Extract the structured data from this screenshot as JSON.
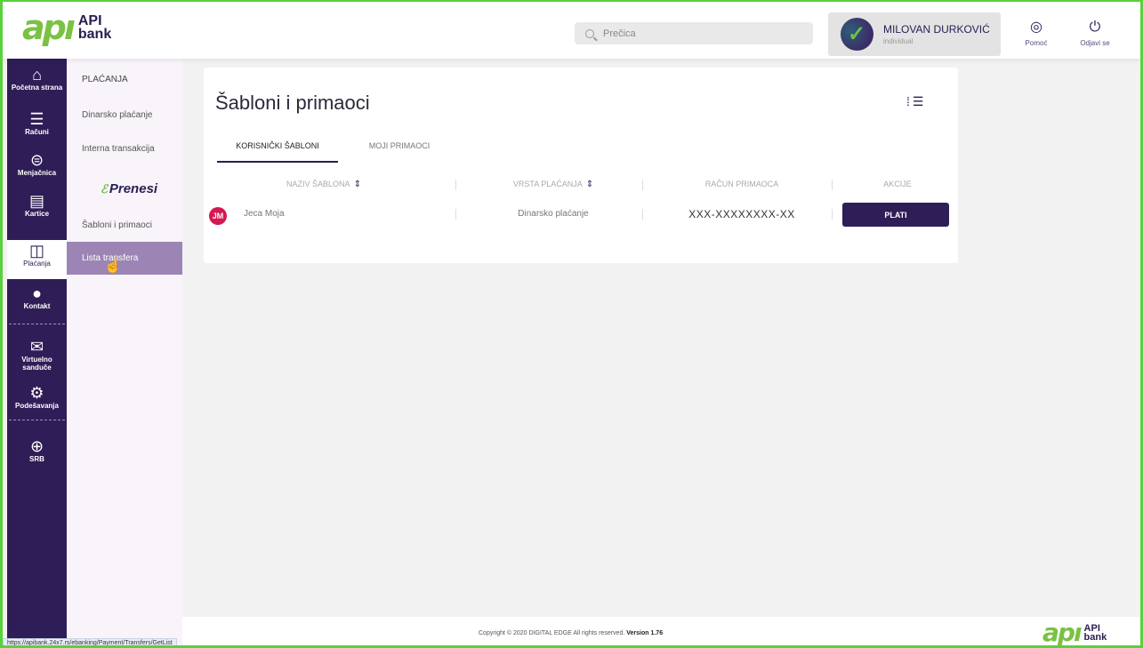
{
  "header": {
    "logo_mark": "apı",
    "logo_text_1": "API",
    "logo_text_2": "bank",
    "search_placeholder": "Prečica",
    "user_name": "MILOVAN DURKOVIĆ",
    "user_type": "individual",
    "help_label": "Pomoć",
    "logout_label": "Odjavi se"
  },
  "iconbar": {
    "items": [
      {
        "label": "Početna strana",
        "icon": "home-icon"
      },
      {
        "label": "Računi",
        "icon": "list-icon"
      },
      {
        "label": "Menjačnica",
        "icon": "exchange-icon"
      },
      {
        "label": "Kartice",
        "icon": "card-icon"
      },
      {
        "label": "Plaćanja",
        "icon": "wallet-icon"
      },
      {
        "label": "Kontakt",
        "icon": "chat-icon"
      },
      {
        "label": "Virtuelno sanduče",
        "icon": "mail-icon"
      },
      {
        "label": "Podešavanja",
        "icon": "gear-icon"
      },
      {
        "label": "SRB",
        "icon": "globe-icon"
      }
    ]
  },
  "submenu": {
    "title": "PLAĆANJA",
    "items": [
      "Dinarsko plaćanje",
      "Interna transakcija",
      "Šabloni i primaoci",
      "Lista transfera"
    ],
    "prenesi": "Prenesi"
  },
  "main": {
    "title": "Šabloni i primaoci",
    "tabs": [
      "KORISNIČKI ŠABLONI",
      "MOJI PRIMAOCI"
    ],
    "columns": [
      "NAZIV ŠABLONA",
      "VRSTA PLAĆANJA",
      "RAČUN PRIMAOCA",
      "AKCIJE"
    ],
    "rows": [
      {
        "initials": "JM",
        "name": "Jeca Moja",
        "type": "Dinarsko plaćanje",
        "account": "XXX-XXXXXXXX-XX",
        "action": "PLATI"
      }
    ]
  },
  "footer": {
    "copyright": "Copyright © 2020 DIGITAL EDGE All rights reserved.",
    "version": "Version 1.76",
    "status_url": "https://apibank.24x7.rs/ebanking/Payment/Transfers/GetList"
  },
  "colors": {
    "brand_purple": "#2f1d57",
    "brand_green": "#7bc142",
    "accent_red": "#d7174f",
    "submenu_active": "#9c85b4"
  }
}
